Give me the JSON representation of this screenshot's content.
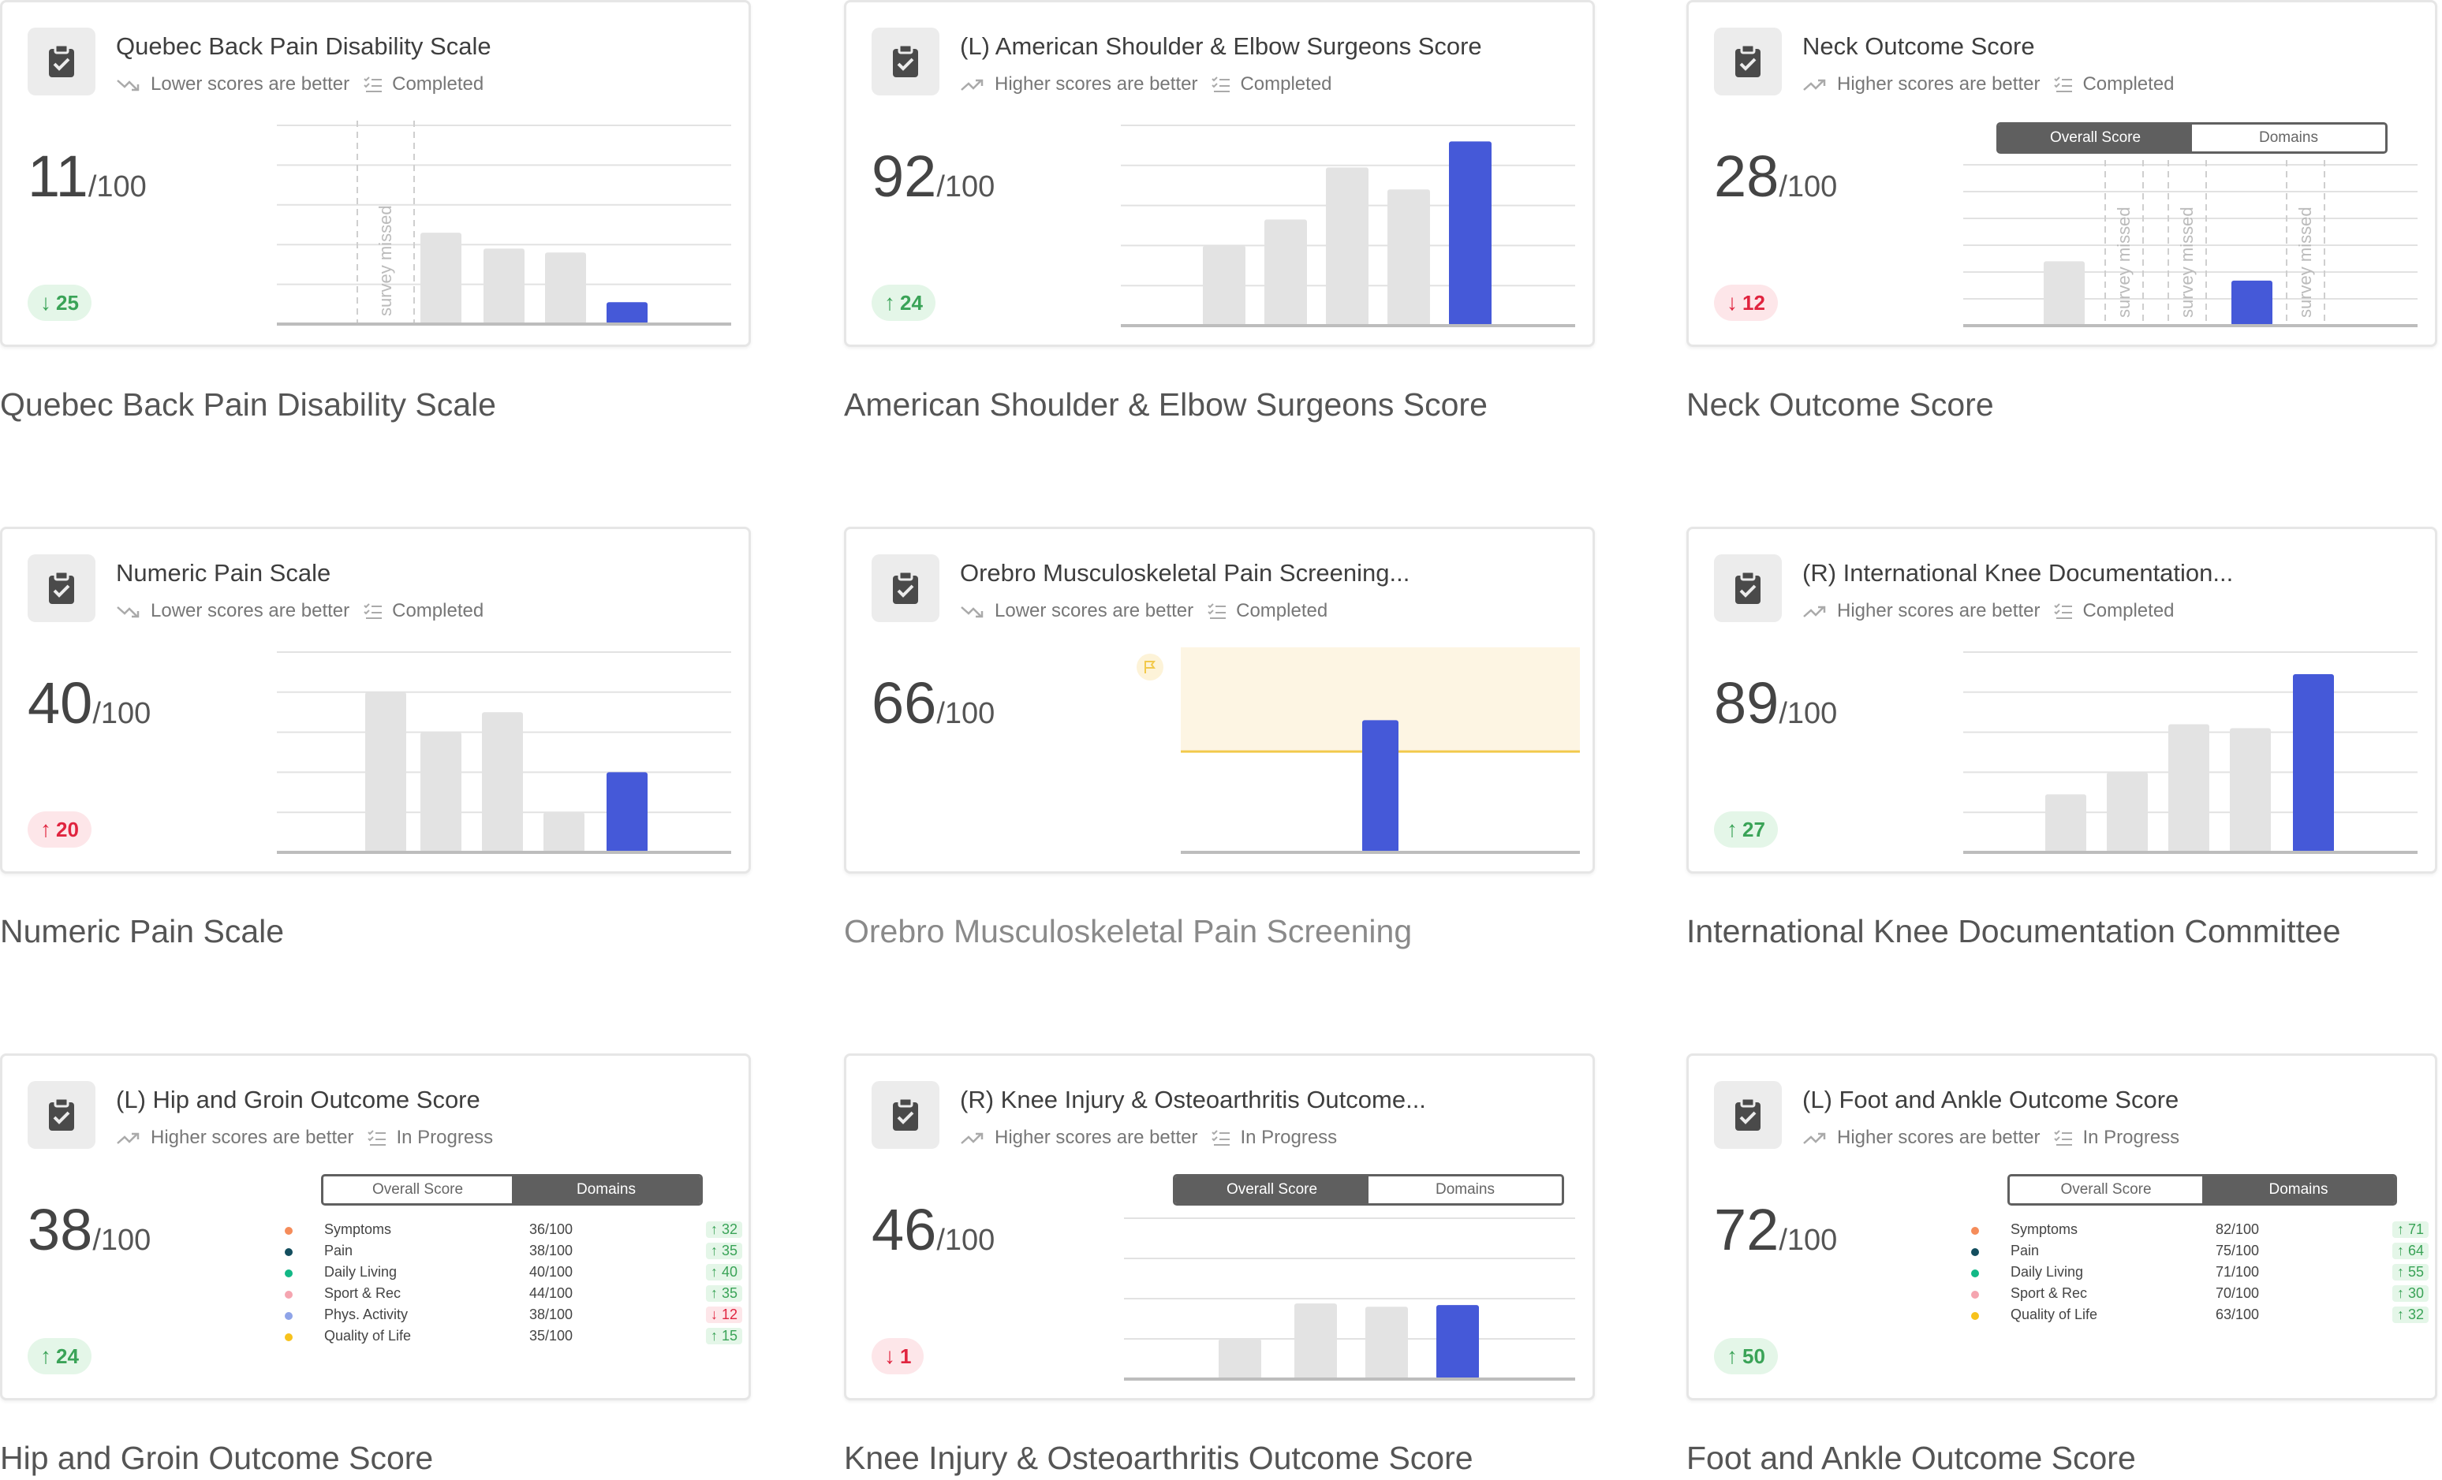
{
  "cards": [
    {
      "title": "Quebec Back Pain Disability Scale",
      "direction": "Lower scores are better",
      "status": "Completed",
      "score": "11",
      "max": "/100",
      "change": "25",
      "change_dir": "down",
      "change_color": "green",
      "caption": "Quebec Back Pain Disability Scale",
      "chart": {
        "bars": [
          {
            "missed": true,
            "label": "survey missed"
          },
          {
            "value": 46
          },
          {
            "value": 38
          },
          {
            "value": 36
          },
          {
            "value": 11,
            "current": true
          }
        ]
      }
    },
    {
      "title": "(L) American Shoulder & Elbow Surgeons Score",
      "direction": "Higher scores are better",
      "status": "Completed",
      "score": "92",
      "max": "/100",
      "change": "24",
      "change_dir": "up",
      "change_color": "green",
      "caption": "American Shoulder & Elbow Surgeons Score",
      "chart": {
        "bars": [
          {
            "value": 40
          },
          {
            "value": 53
          },
          {
            "value": 79
          },
          {
            "value": 68
          },
          {
            "value": 92,
            "current": true
          }
        ]
      }
    },
    {
      "title": "Neck Outcome Score",
      "direction": "Higher scores are better",
      "status": "Completed",
      "score": "28",
      "max": "/100",
      "change": "12",
      "change_dir": "down",
      "change_color": "red",
      "caption": "Neck Outcome Score",
      "toggle": {
        "overall": "Overall Score",
        "domains": "Domains",
        "active": "overall"
      },
      "chart": {
        "bars": [
          {
            "value": 40
          },
          {
            "missed": true,
            "label": "survey missed"
          },
          {
            "missed": true,
            "label": "survey missed"
          },
          {
            "value": 28,
            "current": true
          },
          {
            "missed": true,
            "label": "survey missed"
          }
        ]
      }
    },
    {
      "title": "Numeric Pain Scale",
      "direction": "Lower scores are better",
      "status": "Completed",
      "score": "40",
      "max": "/100",
      "change": "20",
      "change_dir": "up",
      "change_color": "red",
      "caption": "Numeric Pain Scale",
      "chart": {
        "bars": [
          {
            "value": 80
          },
          {
            "value": 60
          },
          {
            "value": 70
          },
          {
            "value": 20
          },
          {
            "value": 40,
            "current": true
          }
        ]
      }
    },
    {
      "title": "Orebro Musculoskeletal Pain Screening...",
      "direction": "Lower scores are better",
      "status": "Completed",
      "score": "66",
      "max": "/100",
      "caption": "Orebro Musculoskeletal Pain Screening",
      "caption_light": true,
      "chart": {
        "threshold_band": true,
        "bars": [
          {
            "value": 66,
            "current": true
          }
        ]
      }
    },
    {
      "title": "(R) International Knee Documentation...",
      "direction": "Higher scores are better",
      "status": "Completed",
      "score": "89",
      "max": "/100",
      "change": "27",
      "change_dir": "up",
      "change_color": "green",
      "caption": "International Knee Documentation Committee",
      "chart": {
        "bars": [
          {
            "value": 29
          },
          {
            "value": 40
          },
          {
            "value": 64
          },
          {
            "value": 62
          },
          {
            "value": 89,
            "current": true
          }
        ]
      }
    },
    {
      "title": "(L) Hip and Groin Outcome Score",
      "direction": "Higher scores are better",
      "status": "In Progress",
      "score": "38",
      "max": "/100",
      "change": "24",
      "change_dir": "up",
      "change_color": "green",
      "caption": "Hip and Groin Outcome Score",
      "toggle": {
        "overall": "Overall Score",
        "domains": "Domains",
        "active": "domains"
      },
      "domains": [
        {
          "name": "Symptoms",
          "value": "36/100",
          "change": "32",
          "dir": "up",
          "color": "#f58c5a",
          "tone": "green"
        },
        {
          "name": "Pain",
          "value": "38/100",
          "change": "35",
          "dir": "up",
          "color": "#134e5e",
          "tone": "green"
        },
        {
          "name": "Daily Living",
          "value": "40/100",
          "change": "40",
          "dir": "up",
          "color": "#12b886",
          "tone": "green"
        },
        {
          "name": "Sport & Rec",
          "value": "44/100",
          "change": "35",
          "dir": "up",
          "color": "#f5a5b0",
          "tone": "green"
        },
        {
          "name": "Phys. Activity",
          "value": "38/100",
          "change": "12",
          "dir": "down",
          "color": "#8fa4e8",
          "tone": "red"
        },
        {
          "name": "Quality of Life",
          "value": "35/100",
          "change": "15",
          "dir": "up",
          "color": "#f7c21c",
          "tone": "green"
        }
      ]
    },
    {
      "title": "(R) Knee Injury & Osteoarthritis Outcome...",
      "direction": "Higher scores are better",
      "status": "In Progress",
      "score": "46",
      "max": "/100",
      "change": "1",
      "change_dir": "down",
      "change_color": "red",
      "caption": "Knee Injury & Osteoarthritis Outcome Score",
      "toggle": {
        "overall": "Overall Score",
        "domains": "Domains",
        "active": "overall"
      },
      "chart": {
        "bars": [
          {
            "value": 25
          },
          {
            "value": 47
          },
          {
            "value": 45
          },
          {
            "value": 46,
            "current": true
          }
        ]
      }
    },
    {
      "title": "(L) Foot and Ankle Outcome Score",
      "direction": "Higher scores are better",
      "status": "In Progress",
      "score": "72",
      "max": "/100",
      "change": "50",
      "change_dir": "up",
      "change_color": "green",
      "caption": "Foot and Ankle Outcome Score",
      "toggle": {
        "overall": "Overall Score",
        "domains": "Domains",
        "active": "domains"
      },
      "domains": [
        {
          "name": "Symptoms",
          "value": "82/100",
          "change": "71",
          "dir": "up",
          "color": "#f58c5a",
          "tone": "green"
        },
        {
          "name": "Pain",
          "value": "75/100",
          "change": "64",
          "dir": "up",
          "color": "#134e5e",
          "tone": "green"
        },
        {
          "name": "Daily Living",
          "value": "71/100",
          "change": "55",
          "dir": "up",
          "color": "#12b886",
          "tone": "green"
        },
        {
          "name": "Sport & Rec",
          "value": "70/100",
          "change": "30",
          "dir": "up",
          "color": "#f5a5b0",
          "tone": "green"
        },
        {
          "name": "Quality of Life",
          "value": "63/100",
          "change": "32",
          "dir": "up",
          "color": "#f7c21c",
          "tone": "green"
        }
      ]
    }
  ],
  "colors": {
    "current_bar": "#4559d8",
    "past_bar": "#e3e3e3",
    "grid": "#e2e2e2",
    "baseline": "#bdbdbd",
    "threshold_fill": "#fdf5e3",
    "threshold_line": "#f2c94c"
  },
  "icons": {
    "card": "clipboard-check-icon",
    "trend": "trend-icon",
    "status": "checklist-icon"
  }
}
